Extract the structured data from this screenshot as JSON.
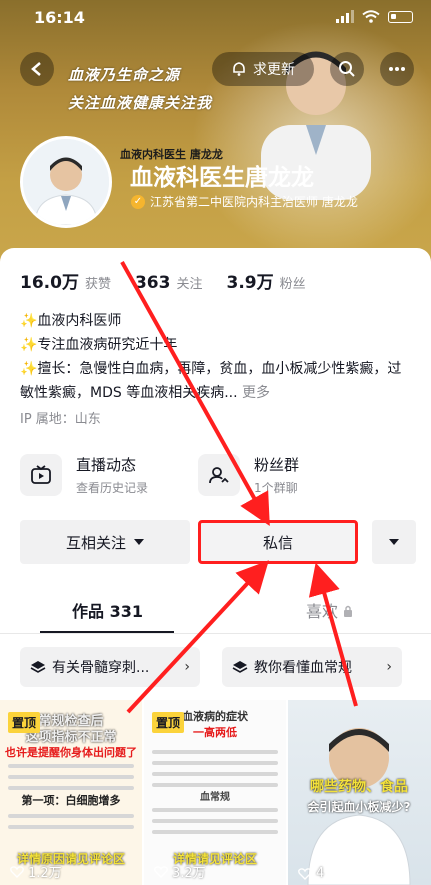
{
  "status_bar": {
    "time": "16:14"
  },
  "header": {
    "refresh_label": "求更新",
    "slogan_line1": "血液乃生命之源",
    "slogan_line2": "关注血液健康关注我",
    "avatar_caption": "血液内科医生 唐龙龙",
    "display_name": "血液科医生唐龙龙",
    "verification": "江苏省第二中医院内科主治医师 唐龙龙"
  },
  "stats": [
    {
      "value": "16.0万",
      "label": "获赞"
    },
    {
      "value": "363",
      "label": "关注"
    },
    {
      "value": "3.9万",
      "label": "粉丝"
    }
  ],
  "bio": {
    "line1": "✨血液内科医师",
    "line2": "✨专注血液病研究近十年",
    "line3": "✨擅长：急慢性白血病，再障，贫血，血小板减少性紫癜，过敏性紫癜，MDS 等血液相关疾病...",
    "more": "更多",
    "ip": "IP 属地：山东"
  },
  "features": [
    {
      "title": "直播动态",
      "subtitle": "查看历史记录",
      "icon": "tv-icon"
    },
    {
      "title": "粉丝群",
      "subtitle": "1个群聊",
      "icon": "group-icon"
    }
  ],
  "actions": {
    "follow": "互相关注",
    "message": "私信"
  },
  "tabs": {
    "works": "作品 331",
    "likes": "喜欢"
  },
  "collections": [
    {
      "label": "有关骨髓穿刺..."
    },
    {
      "label": "教你看懂血常规"
    }
  ],
  "videos": [
    {
      "pinned": "置顶",
      "caption_top": "常规检查后",
      "caption_top2": "这项指标不正常",
      "caption_red": "也许是提醒你身体出问题了",
      "caption_mid": "第一项：白细胞增多",
      "caption_bottom": "详情原因请见评论区",
      "likes": "1.2万"
    },
    {
      "pinned": "置顶",
      "caption_top": "血液病的症状",
      "caption_red": "一高两低",
      "caption_mid": "血常规",
      "caption_bottom": "详情请见评论区",
      "likes": "3.2万"
    },
    {
      "caption_top": "哪些药物、食品",
      "caption_top2": "会引起血小板减少?",
      "likes": "4"
    }
  ],
  "colors": {
    "annotation_red": "#ff1f1f",
    "banner_gold": "#c4a045",
    "pin_yellow": "#fbd33b"
  }
}
